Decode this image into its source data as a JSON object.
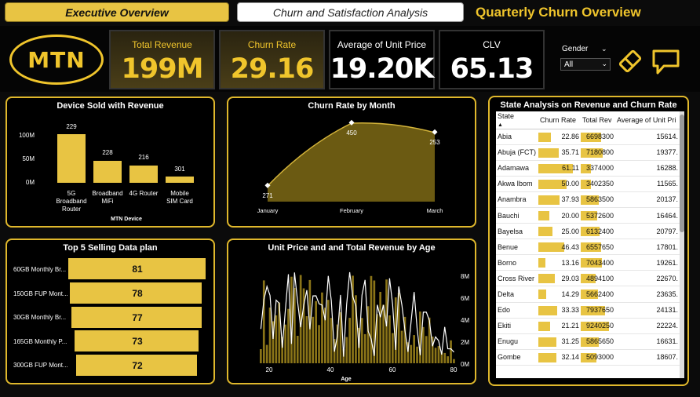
{
  "tabs": {
    "executive": "Executive Overview",
    "churn": "Churn and Satisfaction Analysis"
  },
  "page_title": "Quarterly Churn Overview",
  "logo_text": "MTN",
  "kpis": [
    {
      "label": "Total Revenue",
      "value": "199M"
    },
    {
      "label": "Churn Rate",
      "value": "29.16"
    },
    {
      "label": "Average of Unit Price",
      "value": "19.20K"
    },
    {
      "label": "CLV",
      "value": "65.13"
    }
  ],
  "slicer": {
    "label": "Gender",
    "value": "All"
  },
  "colors": {
    "accent": "#f0c52c",
    "bar": "#e8c443",
    "background": "#000000"
  },
  "device_chart": {
    "title": "Device Sold with Revenue",
    "xlabel": "MTN Device",
    "y_ticks": [
      "100M",
      "50M",
      "0M"
    ],
    "categories": [
      [
        "5G",
        "Broadband",
        "Router"
      ],
      [
        "Broadband",
        "MiFi"
      ],
      [
        "4G Router"
      ],
      [
        "Mobile",
        "SIM Card"
      ]
    ],
    "counts": [
      "229",
      "228",
      "216",
      "301"
    ]
  },
  "churn_chart": {
    "title": "Churn Rate by Month",
    "months": [
      "January",
      "February",
      "March"
    ],
    "labels": [
      "271",
      "450",
      "253"
    ]
  },
  "plans_chart": {
    "title": "Top 5 Selling Data plan",
    "items": [
      {
        "label": "60GB Monthly Br...",
        "value": "81"
      },
      {
        "label": "150GB FUP Mont...",
        "value": "78"
      },
      {
        "label": "30GB Monthly Br...",
        "value": "77"
      },
      {
        "label": "165GB Monthly P...",
        "value": "73"
      },
      {
        "label": "300GB FUP Mont...",
        "value": "72"
      }
    ]
  },
  "age_chart": {
    "title": "Unit Price and and Total Revenue by Age",
    "xlabel": "Age",
    "x_ticks": [
      "20",
      "40",
      "60",
      "80"
    ],
    "y_ticks": [
      "8M",
      "6M",
      "4M",
      "2M",
      "0M"
    ]
  },
  "state_table": {
    "title": "State Analysis on Revenue and Churn Rate",
    "columns": [
      "State",
      "Churn Rate",
      "Total Rev",
      "Average of Unit Pri"
    ],
    "rows": [
      {
        "state": "Abia",
        "churn": "22.86",
        "rev": "6698300",
        "avg": "15614."
      },
      {
        "state": "Abuja (FCT)",
        "churn": "35.71",
        "rev": "7180800",
        "avg": "19377."
      },
      {
        "state": "Adamawa",
        "churn": "61.11",
        "rev": "3374000",
        "avg": "16288."
      },
      {
        "state": "Akwa Ibom",
        "churn": "50.00",
        "rev": "3402350",
        "avg": "11565."
      },
      {
        "state": "Anambra",
        "churn": "37.93",
        "rev": "5863500",
        "avg": "20137."
      },
      {
        "state": "Bauchi",
        "churn": "20.00",
        "rev": "5372600",
        "avg": "16464."
      },
      {
        "state": "Bayelsa",
        "churn": "25.00",
        "rev": "6132400",
        "avg": "20797."
      },
      {
        "state": "Benue",
        "churn": "46.43",
        "rev": "6557650",
        "avg": "17801."
      },
      {
        "state": "Borno",
        "churn": "13.16",
        "rev": "7043400",
        "avg": "19261."
      },
      {
        "state": "Cross River",
        "churn": "29.03",
        "rev": "4894100",
        "avg": "22670."
      },
      {
        "state": "Delta",
        "churn": "14.29",
        "rev": "5662400",
        "avg": "23635."
      },
      {
        "state": "Edo",
        "churn": "33.33",
        "rev": "7937650",
        "avg": "24131."
      },
      {
        "state": "Ekiti",
        "churn": "21.21",
        "rev": "9240250",
        "avg": "22224."
      },
      {
        "state": "Enugu",
        "churn": "31.25",
        "rev": "5865650",
        "avg": "16631."
      },
      {
        "state": "Gombe",
        "churn": "32.14",
        "rev": "5093000",
        "avg": "18607."
      }
    ]
  }
}
